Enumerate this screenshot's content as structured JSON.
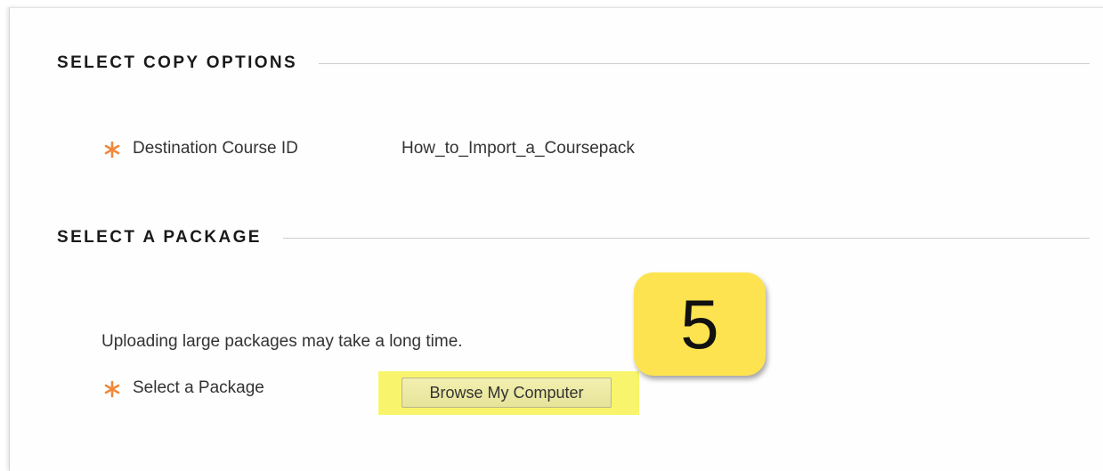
{
  "sections": [
    {
      "heading": "SELECT COPY OPTIONS",
      "fields": [
        {
          "label": "Destination Course ID",
          "value": "How_to_Import_a_Coursepack",
          "required": true
        }
      ]
    },
    {
      "heading": "SELECT A PACKAGE",
      "info": "Uploading large packages may take a long time.",
      "fields": [
        {
          "label": "Select a Package",
          "button_label": "Browse My Computer",
          "required": true
        }
      ]
    }
  ],
  "callout": {
    "step_number": "5",
    "color": "#fde34f"
  },
  "colors": {
    "required_icon": "#f0883c",
    "highlight": "#f8f56c"
  },
  "icons": {
    "required": "asterisk-icon"
  }
}
